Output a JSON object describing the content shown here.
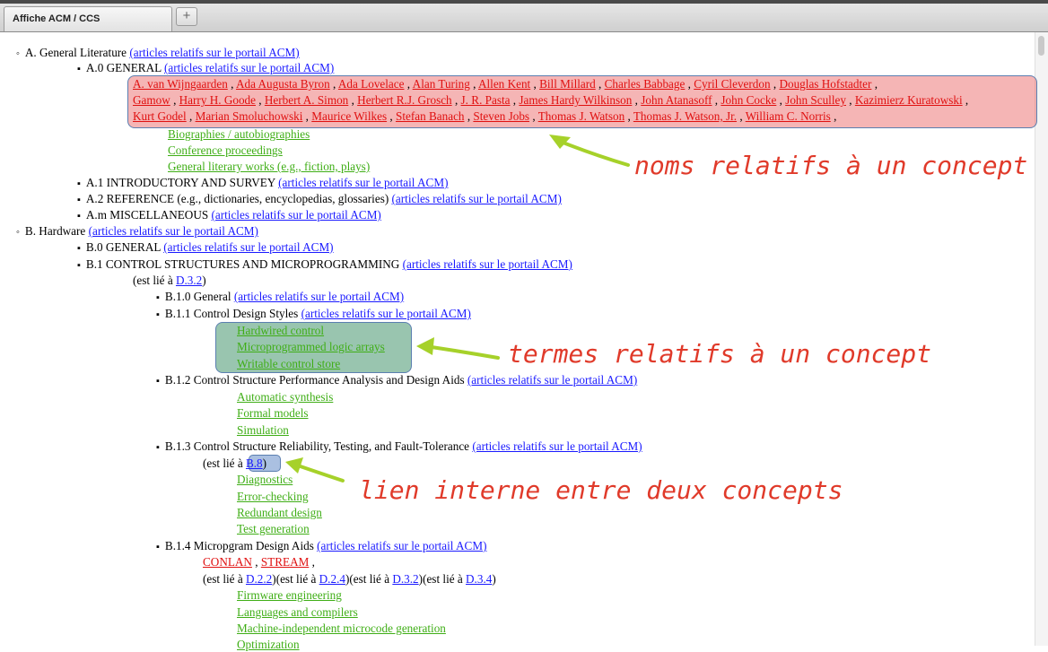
{
  "tabs": {
    "active_label": "Affiche ACM / CCS",
    "new_tab_label": "+"
  },
  "link_text": "(articles relatifs sur le portail ACM)",
  "est_lie": "(est lié à ",
  "tree": {
    "A": "A. General Literature",
    "A0": "A.0 GENERAL",
    "A0_names": [
      "A. van Wijngaarden",
      "Ada Augusta Byron",
      "Ada Lovelace",
      "Alan Turing",
      "Allen Kent",
      "Bill Millard",
      "Charles Babbage",
      "Cyril Cleverdon",
      "Douglas Hofstadter",
      "Gamow",
      "Harry H. Goode",
      "Herbert A. Simon",
      "Herbert R.J. Grosch",
      "J. R. Pasta",
      "James Hardy Wilkinson",
      "John Atanasoff",
      "John Cocke",
      "John Sculley",
      "Kazimierz Kuratowski",
      "Kurt Godel",
      "Marian Smoluchowski",
      "Maurice Wilkes",
      "Stefan Banach",
      "Steven Jobs",
      "Thomas J. Watson",
      "Thomas J. Watson, Jr.",
      "William C. Norris"
    ],
    "A0_terms": [
      "Biographies / autobiographies",
      "Conference proceedings",
      "General literary works (e.g., fiction, plays)"
    ],
    "A1": "A.1 INTRODUCTORY AND SURVEY",
    "A2": "A.2 REFERENCE (e.g., dictionaries, encyclopedias, glossaries)",
    "Am": "A.m MISCELLANEOUS",
    "B": "B. Hardware",
    "B0": "B.0 GENERAL",
    "B1": "B.1 CONTROL STRUCTURES AND MICROPROGRAMMING",
    "B1_ref": "D.3.2",
    "B10": "B.1.0 General",
    "B11": "B.1.1 Control Design Styles",
    "B11_terms": [
      "Hardwired control",
      "Microprogrammed logic arrays",
      "Writable control store"
    ],
    "B12": "B.1.2 Control Structure Performance Analysis and Design Aids",
    "B12_terms": [
      "Automatic synthesis",
      "Formal models",
      "Simulation"
    ],
    "B13": "B.1.3 Control Structure Reliability, Testing, and Fault-Tolerance",
    "B13_ref": "B.8",
    "B13_terms": [
      "Diagnostics",
      "Error-checking",
      "Redundant design",
      "Test generation"
    ],
    "B14": "B.1.4 Micropgram Design Aids",
    "B14_names": [
      "CONLAN",
      "STREAM"
    ],
    "B14_refs": [
      "D.2.2",
      "D.2.4",
      "D.3.2",
      "D.3.4"
    ],
    "B14_terms": [
      "Firmware engineering",
      "Languages and compilers",
      "Machine-independent microcode generation",
      "Optimization"
    ]
  },
  "annotations": {
    "names": "noms relatifs à un concept",
    "terms": "termes relatifs à un concept",
    "link": "lien interne entre deux concepts"
  },
  "colors": {
    "link": "#1a1aff",
    "name": "#e01010",
    "term": "#3fae16",
    "annotation": "#e03a2a",
    "arrow": "#a6d12a"
  }
}
